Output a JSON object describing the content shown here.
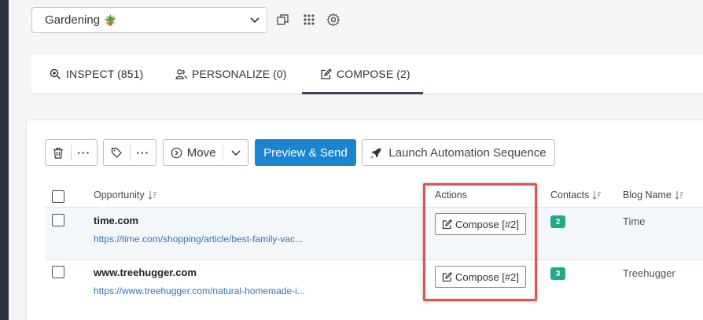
{
  "header": {
    "campaign": "Gardening",
    "campaign_emoji": "🪴"
  },
  "tabs": [
    {
      "label": "INSPECT (851)"
    },
    {
      "label": "PERSONALIZE (0)"
    },
    {
      "label": "COMPOSE (2)"
    }
  ],
  "toolbar": {
    "move_label": "Move",
    "preview_label": "Preview & Send",
    "launch_label": "Launch Automation Sequence"
  },
  "table": {
    "columns": {
      "opportunity": "Opportunity",
      "actions": "Actions",
      "contacts": "Contacts",
      "blog_name": "Blog Name"
    },
    "rows": [
      {
        "site": "time.com",
        "url": "https://time.com/shopping/article/best-family-vac...",
        "action": "Compose [#2]",
        "contacts": "2",
        "blog": "Time"
      },
      {
        "site": "www.treehugger.com",
        "url": "https://www.treehugger.com/natural-homemade-i...",
        "action": "Compose [#2]",
        "contacts": "3",
        "blog": "Treehugger"
      }
    ]
  },
  "colors": {
    "primary": "#1a84d0",
    "badge": "#21a98a",
    "highlight": "#e2544a",
    "link": "#2a74c0"
  }
}
